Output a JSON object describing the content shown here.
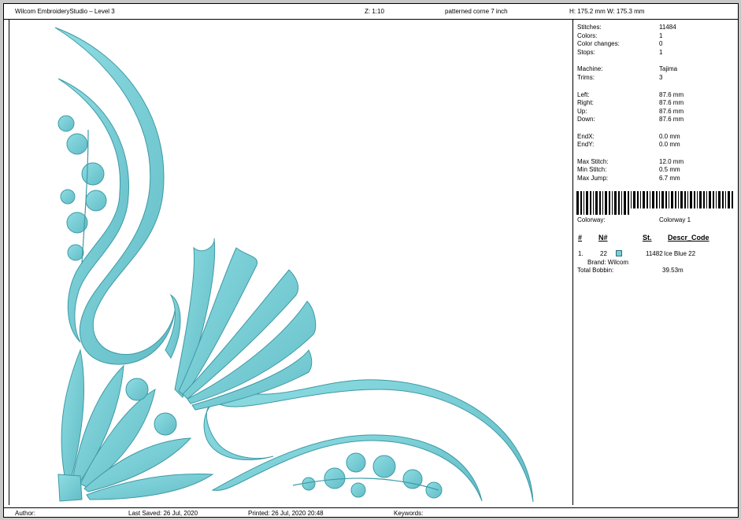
{
  "header": {
    "app_title": "Wilcom EmbroideryStudio – Level 3",
    "zoom": "Z: 1:10",
    "design_name": "patterned corne 7  inch",
    "size": "H: 175.2 mm   W: 175.3 mm"
  },
  "stats": [
    {
      "label": "Stitches:",
      "value": "11484"
    },
    {
      "label": "Colors:",
      "value": "1"
    },
    {
      "label": "Color changes:",
      "value": "0"
    },
    {
      "label": "Stops:",
      "value": "1"
    },
    {
      "label": "Machine:",
      "value": "Tajima"
    },
    {
      "label": "Trims:",
      "value": "3"
    },
    {
      "label": "Left:",
      "value": "87.6 mm"
    },
    {
      "label": "Right:",
      "value": "87.6 mm"
    },
    {
      "label": "Up:",
      "value": "87.6 mm"
    },
    {
      "label": "Down:",
      "value": "87.6 mm"
    },
    {
      "label": "EndX:",
      "value": "0.0 mm"
    },
    {
      "label": "EndY:",
      "value": "0.0 mm"
    },
    {
      "label": "Max Stitch:",
      "value": "12.0 mm"
    },
    {
      "label": "Min Stitch:",
      "value": "0.5 mm"
    },
    {
      "label": "Max Jump:",
      "value": "6.7 mm"
    }
  ],
  "colorway": {
    "label": "Colorway:",
    "value": "Colorway 1"
  },
  "thread_table": {
    "headers": {
      "num": "#",
      "n_num": "N#",
      "st": "St.",
      "descr": "Descr_Code"
    },
    "rows": [
      {
        "index": "1.",
        "n": "22",
        "color": "#7bcfd6",
        "stitches": "11482",
        "descr": "Ice Blue 22",
        "brand": "Brand: Wilcom"
      }
    ]
  },
  "total_bobbin": {
    "label": "Total Bobbin:",
    "value": "39.53m"
  },
  "footer": {
    "author": "Author:",
    "last_saved": "Last Saved: 26 Jul, 2020",
    "printed": "Printed: 26 Jul, 2020 20:48",
    "keywords": "Keywords:"
  },
  "colors": {
    "thread": "#7bcfd6",
    "thread_dark": "#3e9aa5"
  }
}
